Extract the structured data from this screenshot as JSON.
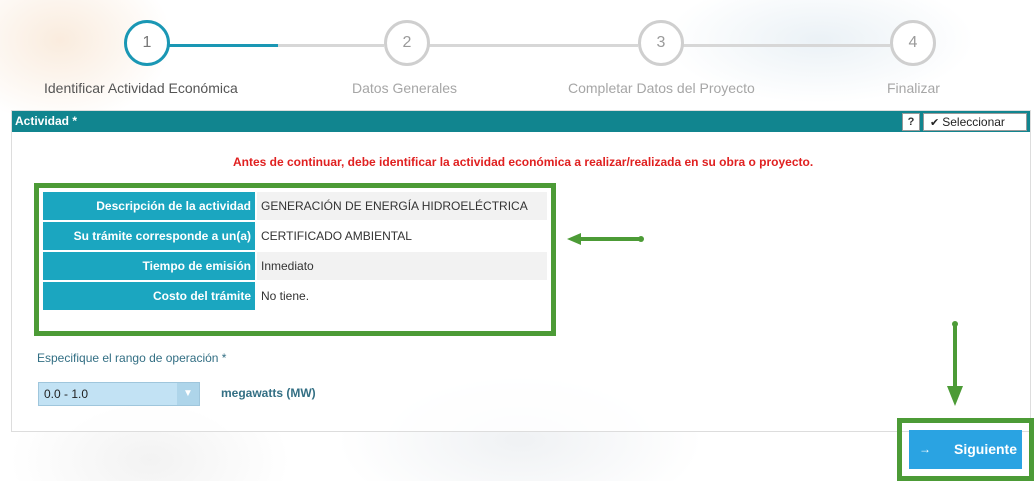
{
  "wizard": {
    "steps": [
      {
        "number": "1",
        "label": "Identificar Actividad Económica",
        "active": true
      },
      {
        "number": "2",
        "label": "Datos Generales",
        "active": false
      },
      {
        "number": "3",
        "label": "Completar Datos del Proyecto",
        "active": false
      },
      {
        "number": "4",
        "label": "Finalizar",
        "active": false
      }
    ]
  },
  "panel": {
    "title": "Actividad *",
    "help_label": "?",
    "select_label": "Seleccionar",
    "warning": "Antes de continuar, debe identificar la actividad económica a realizar/realizada en su obra o proyecto."
  },
  "info": {
    "rows": [
      {
        "key": "Descripción de la actividad",
        "value": "GENERACIÓN DE ENERGÍA HIDROELÉCTRICA"
      },
      {
        "key": "Su trámite corresponde a un(a)",
        "value": "CERTIFICADO AMBIENTAL"
      },
      {
        "key": "Tiempo de emisión",
        "value": "Inmediato"
      },
      {
        "key": "Costo del trámite",
        "value": "No tiene."
      }
    ]
  },
  "range": {
    "label": "Especifique el rango de operación *",
    "selected": "0.0 - 1.0",
    "unit": "megawatts (MW)"
  },
  "next_button": {
    "label": "Siguiente",
    "icon": "arrow-right-icon"
  },
  "colors": {
    "teal_header": "#11858f",
    "step_active": "#1a97b4",
    "key_cell": "#1ba6c0",
    "highlight_green": "#4c9b36",
    "button_blue": "#2aa3e2",
    "warning_red": "#e02020"
  }
}
